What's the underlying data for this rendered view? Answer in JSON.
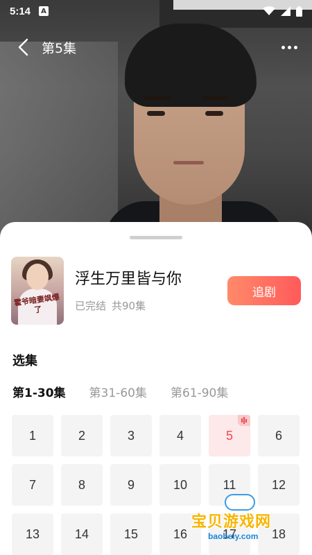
{
  "status_bar": {
    "time": "5:14",
    "notification_letter": "A",
    "icons": [
      "wifi-icon",
      "signal-icon",
      "battery-icon"
    ]
  },
  "top_bar": {
    "title": "第5集",
    "back_icon": "chevron-left-icon",
    "more_icon": "more-dots-icon"
  },
  "drama": {
    "title": "浮生万里皆与你",
    "status": "已完结",
    "episode_count": "共90集",
    "cover_text": "霍爷暗妻飒爆了",
    "follow_label": "追剧"
  },
  "episodes": {
    "section_title": "选集",
    "ranges": [
      "第1-30集",
      "第31-60集",
      "第61-90集"
    ],
    "active_range": 0,
    "current_episode": "5",
    "visible": [
      "1",
      "2",
      "3",
      "4",
      "5",
      "6",
      "7",
      "8",
      "9",
      "10",
      "11",
      "12",
      "13",
      "14",
      "15",
      "16",
      "17",
      "18"
    ]
  },
  "watermark": {
    "text": "宝贝游戏网",
    "url": "baobeiy.com"
  },
  "colors": {
    "accent": "#f2454d",
    "follow_gradient_start": "#ff8a6a",
    "follow_gradient_end": "#ff5a5a"
  }
}
